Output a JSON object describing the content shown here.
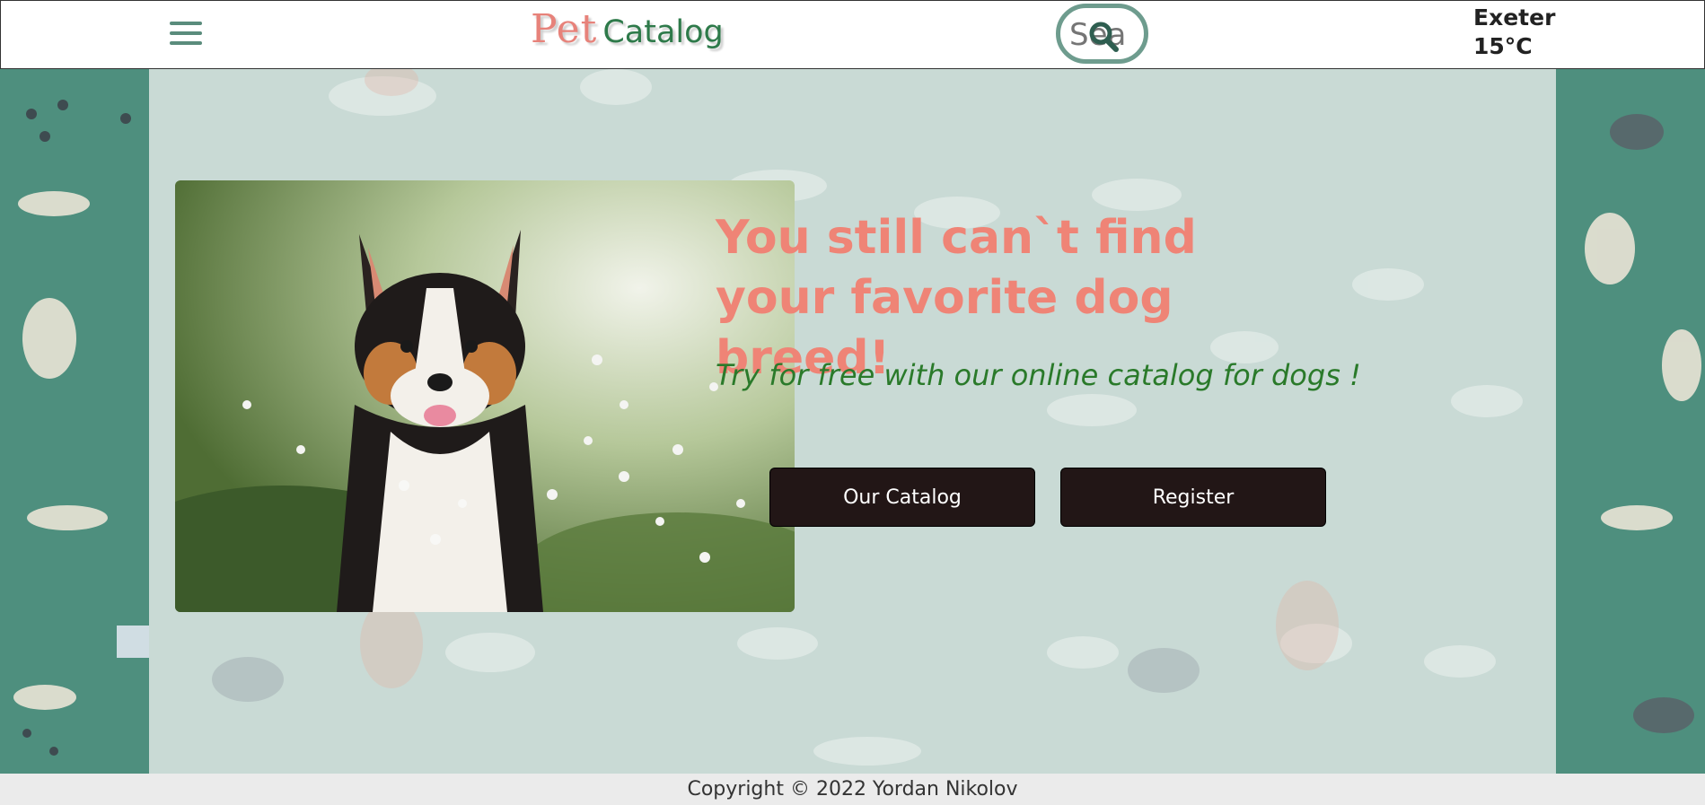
{
  "header": {
    "menu_icon": "hamburger-icon",
    "logo": {
      "pet": "Pet",
      "catalog": "Catalog"
    },
    "search": {
      "placeholder": "Sea",
      "icon": "search-icon"
    },
    "weather": {
      "city": "Exeter",
      "temperature": "15°C"
    }
  },
  "hero": {
    "headline": "You still can`t find your favorite dog breed!",
    "tagline": "Try for free with our online catalog for dogs !",
    "buttons": {
      "catalog": "Our Catalog",
      "register": "Register"
    }
  },
  "footer": {
    "copyright": "Copyright © 2022 Yordan Nikolov"
  },
  "colors": {
    "brand_pink": "#ef8476",
    "brand_green": "#2e7a4a",
    "side_teal": "#4e8f7e",
    "panel_bg": "#c9dad5",
    "button_bg": "#221616"
  }
}
